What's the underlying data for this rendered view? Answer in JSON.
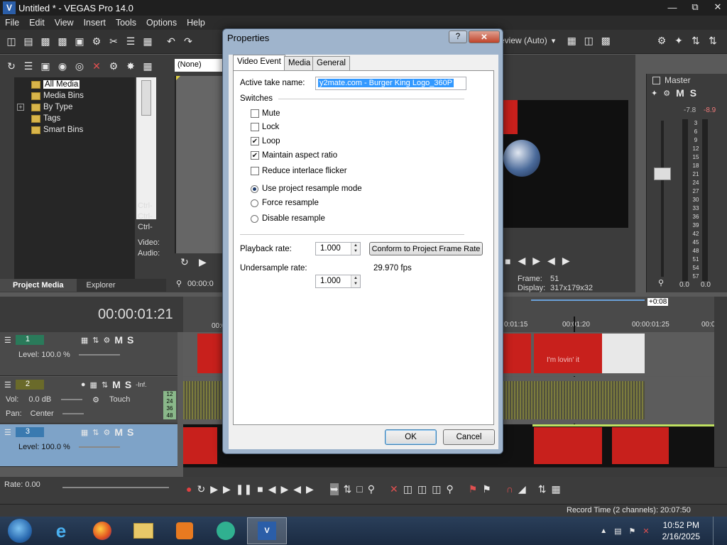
{
  "window": {
    "title": "Untitled * - VEGAS Pro 14.0"
  },
  "menu": [
    "File",
    "Edit",
    "View",
    "Insert",
    "Tools",
    "Options",
    "Help"
  ],
  "explorer": {
    "tree": [
      {
        "label": "All Media",
        "selected": true
      },
      {
        "label": "Media Bins"
      },
      {
        "label": "By Type"
      },
      {
        "label": "Tags"
      },
      {
        "label": "Smart Bins"
      }
    ],
    "tabs": [
      "Project Media",
      "Explorer"
    ]
  },
  "trimmer": {
    "dropdown": "(None)",
    "time": "00:00:0",
    "side_text": [
      "Ctrl-",
      "Ctrl-",
      "Ctrl-",
      "Video:",
      "Audio:"
    ]
  },
  "preview": {
    "mode": "review (Auto)",
    "frame_label": "Frame:",
    "frame_value": "51",
    "display_label": "Display:",
    "display_value": "317x179x32"
  },
  "master": {
    "label": "Master",
    "left_level": "-7.8",
    "right_level": "-8.9",
    "scale": [
      "3",
      "6",
      "9",
      "12",
      "15",
      "18",
      "21",
      "24",
      "27",
      "30",
      "33",
      "36",
      "39",
      "42",
      "45",
      "48",
      "51",
      "54",
      "57"
    ],
    "bottom_left": "0.0",
    "bottom_right": "0.0"
  },
  "timeline": {
    "timecode": "00:00:01:21",
    "offset_badge": "+0:08",
    "ruler": [
      "00:0",
      "0:01:15",
      "00:01:20",
      "00:00:01:25",
      "00:0"
    ],
    "clip_caption": "I'm lovin' it",
    "tracks": [
      {
        "num": "1",
        "level": "Level: 100.0 %"
      },
      {
        "num": "2",
        "vol": "Vol:",
        "vol_val": "0.0 dB",
        "pan": "Pan:",
        "pan_val": "Center",
        "touch": "Touch",
        "inf": "-Inf.",
        "meter": [
          "12",
          "24",
          "36",
          "48"
        ]
      },
      {
        "num": "3",
        "level": "Level: 100.0 %"
      }
    ],
    "rate": "Rate: 0.00"
  },
  "status": {
    "record_time": "Record Time (2 channels): 20:07:50"
  },
  "dialog": {
    "title": "Properties",
    "help": "?",
    "tabs": [
      "Video Event",
      "Media",
      "General"
    ],
    "take_label": "Active take name:",
    "take_value": "y2mate.com - Burger King Logo_360P",
    "switches_label": "Switches",
    "checkboxes": [
      {
        "label": "Mute",
        "checked": false
      },
      {
        "label": "Lock",
        "checked": false
      },
      {
        "label": "Loop",
        "checked": true
      },
      {
        "label": "Maintain aspect ratio",
        "checked": true
      },
      {
        "label": "Reduce interlace flicker",
        "checked": false
      }
    ],
    "radios": [
      {
        "label": "Use project resample mode",
        "selected": true
      },
      {
        "label": "Force resample",
        "selected": false
      },
      {
        "label": "Disable resample",
        "selected": false
      }
    ],
    "playback_label": "Playback rate:",
    "playback_value": "1.000",
    "conform_button": "Conform to Project Frame Rate",
    "undersample_label": "Undersample rate:",
    "undersample_value": "1.000",
    "fps": "29.970 fps",
    "ok": "OK",
    "cancel": "Cancel"
  },
  "taskbar": {
    "time": "10:52 PM",
    "date": "2/16/2025"
  }
}
